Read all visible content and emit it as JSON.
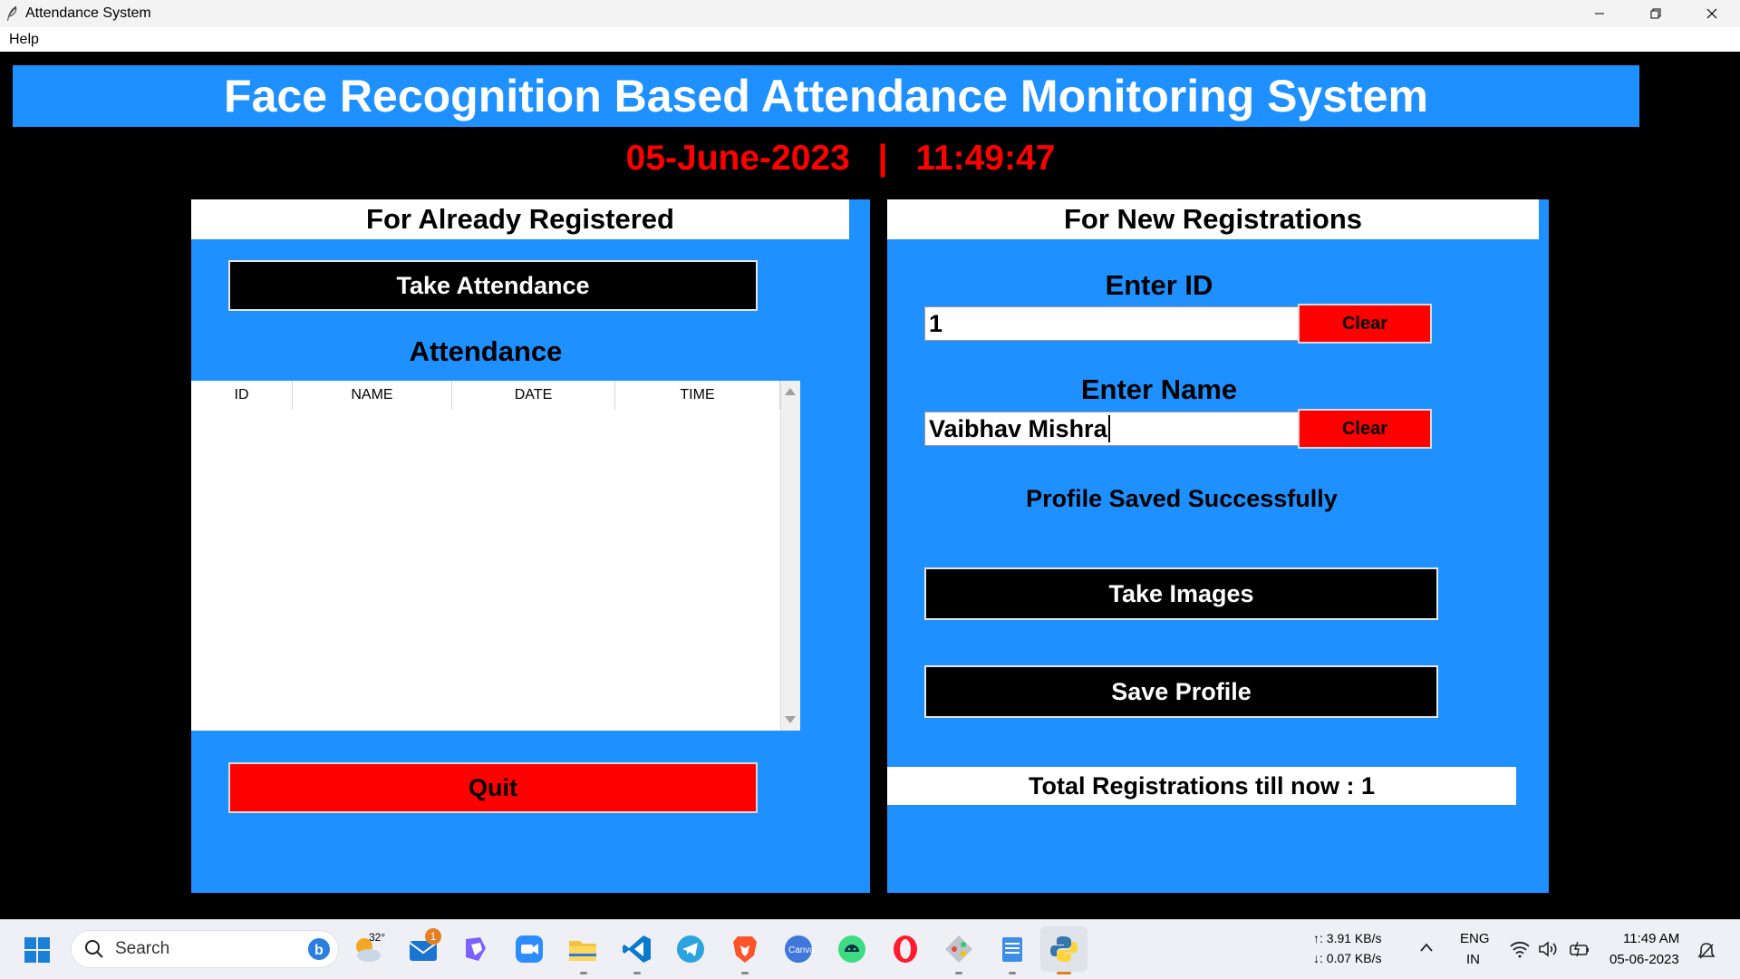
{
  "window": {
    "title": "Attendance System",
    "menu": [
      "Help"
    ]
  },
  "banner": {
    "title": "Face Recognition Based Attendance Monitoring System"
  },
  "datetime": {
    "date": "05-June-2023",
    "separator": "|",
    "time": "11:49:47"
  },
  "left_panel": {
    "header": "For Already Registered",
    "take_attendance_label": "Take Attendance",
    "attendance_title": "Attendance",
    "table_columns": [
      "ID",
      "NAME",
      "DATE",
      "TIME"
    ],
    "table_rows": [],
    "quit_label": "Quit"
  },
  "right_panel": {
    "header": "For New Registrations",
    "id_label": "Enter ID",
    "id_value": "1",
    "name_label": "Enter Name",
    "name_value": "Vaibhav Mishra",
    "clear_label": "Clear",
    "status_message": "Profile Saved Successfully",
    "take_images_label": "Take Images",
    "save_profile_label": "Save Profile",
    "total_registrations": "Total Registrations till now  : 1"
  },
  "taskbar": {
    "search_label": "Search",
    "weather_temp": "32°",
    "mail_badge": "1",
    "net_up": "↑: 3.91 KB/s",
    "net_down": "↓: 0.07 KB/s",
    "lang_line1": "ENG",
    "lang_line2": "IN",
    "clock_time": "11:49 AM",
    "clock_date": "05-06-2023",
    "apps": [
      "weather",
      "mail",
      "copilot",
      "zoom",
      "file-explorer",
      "vscode",
      "telegram",
      "brave",
      "canva",
      "android-studio",
      "opera",
      "sourcetree",
      "notepad",
      "python"
    ]
  },
  "colors": {
    "panel_blue": "#1e90ff",
    "date_red": "#ff0000",
    "button_red": "#ff0000",
    "button_black": "#000000"
  }
}
